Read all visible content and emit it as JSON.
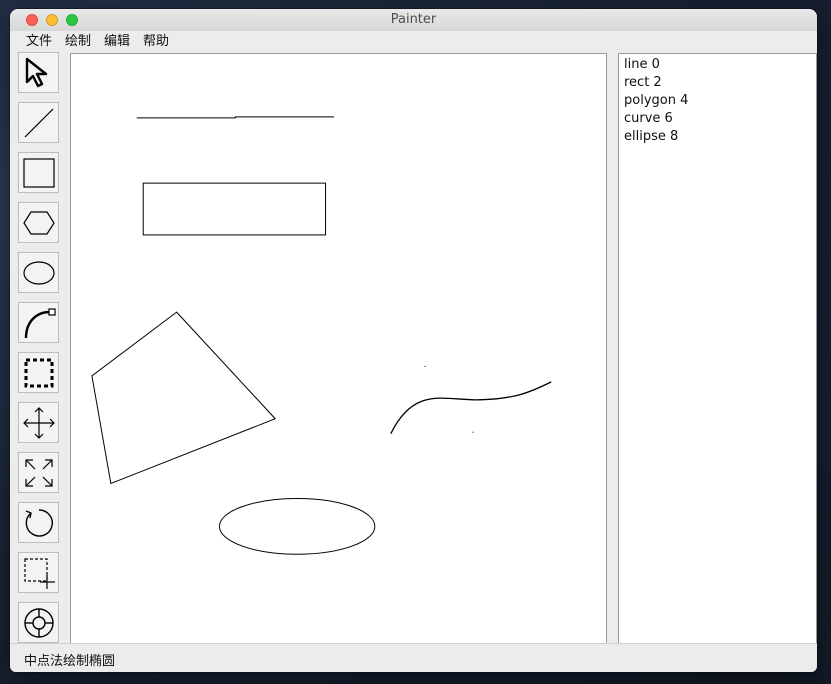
{
  "window": {
    "title": "Painter"
  },
  "menubar": {
    "items": [
      {
        "label": "文件"
      },
      {
        "label": "绘制"
      },
      {
        "label": "编辑"
      },
      {
        "label": "帮助"
      }
    ]
  },
  "toolbar": {
    "tools": [
      {
        "icon": "select-arrow-icon"
      },
      {
        "icon": "line-icon"
      },
      {
        "icon": "rectangle-icon"
      },
      {
        "icon": "polygon-icon"
      },
      {
        "icon": "ellipse-icon"
      },
      {
        "icon": "curve-icon"
      },
      {
        "icon": "dashed-selection-icon"
      },
      {
        "icon": "move-arrows-icon"
      },
      {
        "icon": "resize-arrows-icon"
      },
      {
        "icon": "rotate-icon"
      },
      {
        "icon": "clip-crop-icon"
      },
      {
        "icon": "lifebuoy-icon"
      }
    ]
  },
  "shape_list": {
    "items": [
      {
        "label": "line 0"
      },
      {
        "label": "rect 2"
      },
      {
        "label": "polygon 4"
      },
      {
        "label": "curve 6"
      },
      {
        "label": "ellipse 8"
      }
    ]
  },
  "status": {
    "text": "中点法绘制椭圆"
  },
  "colors": {
    "close": "#fe5f57",
    "minimize": "#febc2e",
    "maximize": "#28c840",
    "stroke": "#000000"
  }
}
